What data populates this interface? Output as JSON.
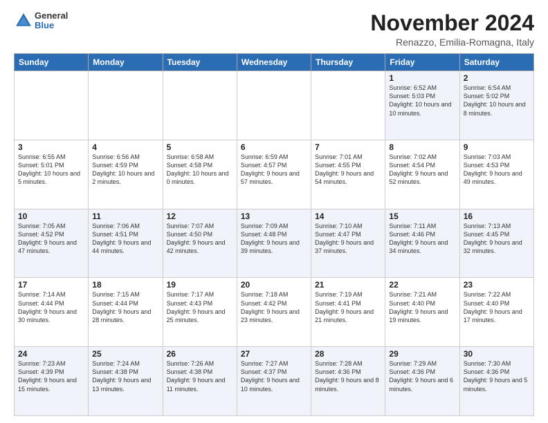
{
  "header": {
    "logo": {
      "general": "General",
      "blue": "Blue"
    },
    "title": "November 2024",
    "location": "Renazzo, Emilia-Romagna, Italy"
  },
  "calendar": {
    "days_of_week": [
      "Sunday",
      "Monday",
      "Tuesday",
      "Wednesday",
      "Thursday",
      "Friday",
      "Saturday"
    ],
    "weeks": [
      [
        {
          "day": "",
          "info": ""
        },
        {
          "day": "",
          "info": ""
        },
        {
          "day": "",
          "info": ""
        },
        {
          "day": "",
          "info": ""
        },
        {
          "day": "",
          "info": ""
        },
        {
          "day": "1",
          "info": "Sunrise: 6:52 AM\nSunset: 5:03 PM\nDaylight: 10 hours and 10 minutes."
        },
        {
          "day": "2",
          "info": "Sunrise: 6:54 AM\nSunset: 5:02 PM\nDaylight: 10 hours and 8 minutes."
        }
      ],
      [
        {
          "day": "3",
          "info": "Sunrise: 6:55 AM\nSunset: 5:01 PM\nDaylight: 10 hours and 5 minutes."
        },
        {
          "day": "4",
          "info": "Sunrise: 6:56 AM\nSunset: 4:59 PM\nDaylight: 10 hours and 2 minutes."
        },
        {
          "day": "5",
          "info": "Sunrise: 6:58 AM\nSunset: 4:58 PM\nDaylight: 10 hours and 0 minutes."
        },
        {
          "day": "6",
          "info": "Sunrise: 6:59 AM\nSunset: 4:57 PM\nDaylight: 9 hours and 57 minutes."
        },
        {
          "day": "7",
          "info": "Sunrise: 7:01 AM\nSunset: 4:55 PM\nDaylight: 9 hours and 54 minutes."
        },
        {
          "day": "8",
          "info": "Sunrise: 7:02 AM\nSunset: 4:54 PM\nDaylight: 9 hours and 52 minutes."
        },
        {
          "day": "9",
          "info": "Sunrise: 7:03 AM\nSunset: 4:53 PM\nDaylight: 9 hours and 49 minutes."
        }
      ],
      [
        {
          "day": "10",
          "info": "Sunrise: 7:05 AM\nSunset: 4:52 PM\nDaylight: 9 hours and 47 minutes."
        },
        {
          "day": "11",
          "info": "Sunrise: 7:06 AM\nSunset: 4:51 PM\nDaylight: 9 hours and 44 minutes."
        },
        {
          "day": "12",
          "info": "Sunrise: 7:07 AM\nSunset: 4:50 PM\nDaylight: 9 hours and 42 minutes."
        },
        {
          "day": "13",
          "info": "Sunrise: 7:09 AM\nSunset: 4:48 PM\nDaylight: 9 hours and 39 minutes."
        },
        {
          "day": "14",
          "info": "Sunrise: 7:10 AM\nSunset: 4:47 PM\nDaylight: 9 hours and 37 minutes."
        },
        {
          "day": "15",
          "info": "Sunrise: 7:11 AM\nSunset: 4:46 PM\nDaylight: 9 hours and 34 minutes."
        },
        {
          "day": "16",
          "info": "Sunrise: 7:13 AM\nSunset: 4:45 PM\nDaylight: 9 hours and 32 minutes."
        }
      ],
      [
        {
          "day": "17",
          "info": "Sunrise: 7:14 AM\nSunset: 4:44 PM\nDaylight: 9 hours and 30 minutes."
        },
        {
          "day": "18",
          "info": "Sunrise: 7:15 AM\nSunset: 4:44 PM\nDaylight: 9 hours and 28 minutes."
        },
        {
          "day": "19",
          "info": "Sunrise: 7:17 AM\nSunset: 4:43 PM\nDaylight: 9 hours and 25 minutes."
        },
        {
          "day": "20",
          "info": "Sunrise: 7:18 AM\nSunset: 4:42 PM\nDaylight: 9 hours and 23 minutes."
        },
        {
          "day": "21",
          "info": "Sunrise: 7:19 AM\nSunset: 4:41 PM\nDaylight: 9 hours and 21 minutes."
        },
        {
          "day": "22",
          "info": "Sunrise: 7:21 AM\nSunset: 4:40 PM\nDaylight: 9 hours and 19 minutes."
        },
        {
          "day": "23",
          "info": "Sunrise: 7:22 AM\nSunset: 4:40 PM\nDaylight: 9 hours and 17 minutes."
        }
      ],
      [
        {
          "day": "24",
          "info": "Sunrise: 7:23 AM\nSunset: 4:39 PM\nDaylight: 9 hours and 15 minutes."
        },
        {
          "day": "25",
          "info": "Sunrise: 7:24 AM\nSunset: 4:38 PM\nDaylight: 9 hours and 13 minutes."
        },
        {
          "day": "26",
          "info": "Sunrise: 7:26 AM\nSunset: 4:38 PM\nDaylight: 9 hours and 11 minutes."
        },
        {
          "day": "27",
          "info": "Sunrise: 7:27 AM\nSunset: 4:37 PM\nDaylight: 9 hours and 10 minutes."
        },
        {
          "day": "28",
          "info": "Sunrise: 7:28 AM\nSunset: 4:36 PM\nDaylight: 9 hours and 8 minutes."
        },
        {
          "day": "29",
          "info": "Sunrise: 7:29 AM\nSunset: 4:36 PM\nDaylight: 9 hours and 6 minutes."
        },
        {
          "day": "30",
          "info": "Sunrise: 7:30 AM\nSunset: 4:36 PM\nDaylight: 9 hours and 5 minutes."
        }
      ]
    ]
  }
}
